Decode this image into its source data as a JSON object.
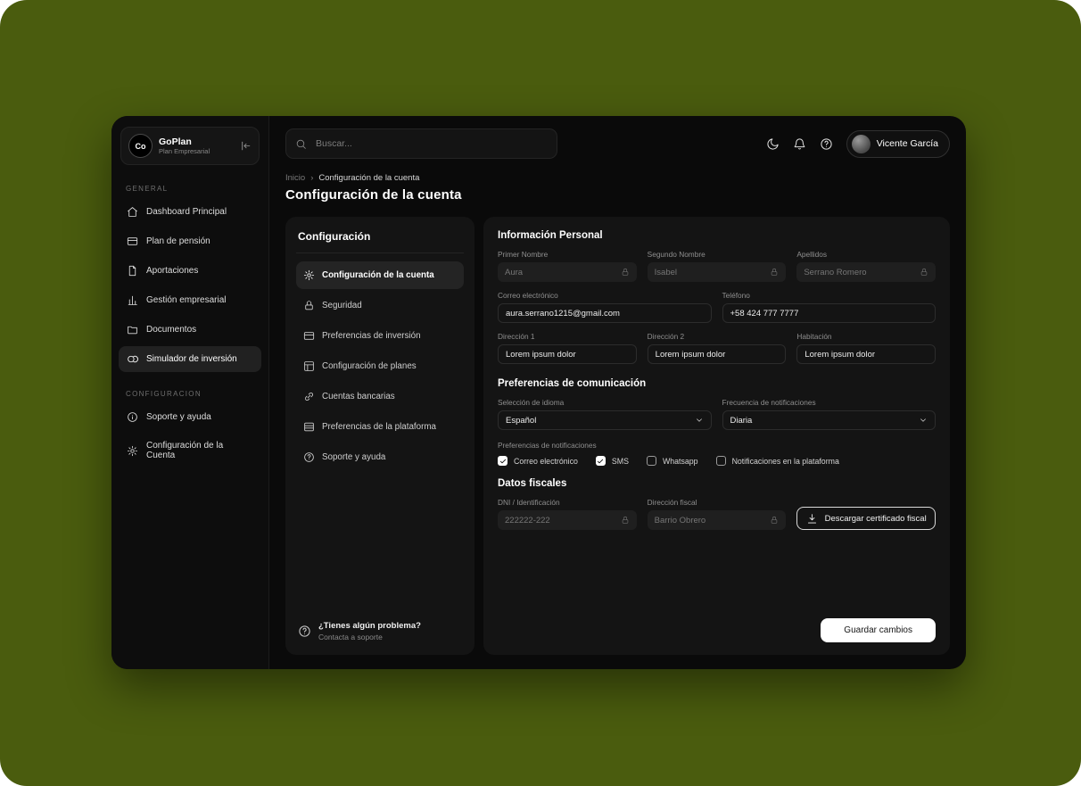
{
  "theme": {
    "background_green": "#4a5c0e",
    "window_bg": "#0a0a0a",
    "panel_bg": "#141414",
    "accent_white": "#ffffff",
    "locked_field_bg": "#1f1f1f"
  },
  "sidebar": {
    "logo": {
      "monogram": "Co",
      "name": "GoPlan",
      "subtitle": "Plan Empresarial"
    },
    "sections": [
      {
        "label": "GENERAL",
        "items": [
          {
            "icon": "home-icon",
            "label": "Dashboard Principal"
          },
          {
            "icon": "credit-card-icon",
            "label": "Plan de pensión"
          },
          {
            "icon": "file-icon",
            "label": "Aportaciones"
          },
          {
            "icon": "bar-chart-icon",
            "label": "Gestión empresarial"
          },
          {
            "icon": "folder-icon",
            "label": "Documentos"
          },
          {
            "icon": "coins-icon",
            "label": "Simulador de inversión",
            "active": true
          }
        ]
      },
      {
        "label": "CONFIGURACION",
        "items": [
          {
            "icon": "info-icon",
            "label": "Soporte y ayuda"
          },
          {
            "icon": "gear-icon",
            "label": "Configuración de la Cuenta"
          }
        ]
      }
    ]
  },
  "topbar": {
    "search_placeholder": "Buscar...",
    "user_name": "Vicente García"
  },
  "breadcrumb": {
    "home": "Inicio",
    "separator": "›",
    "current": "Configuración de la cuenta"
  },
  "page": {
    "title": "Configuración de la cuenta"
  },
  "settings_nav": {
    "title": "Configuración",
    "items": [
      {
        "label": "Configuración de la cuenta",
        "active": true
      },
      {
        "label": "Seguridad"
      },
      {
        "label": "Preferencias de inversión"
      },
      {
        "label": "Configuración de planes"
      },
      {
        "label": "Cuentas bancarias"
      },
      {
        "label": "Preferencias de la plataforma"
      },
      {
        "label": "Soporte y ayuda"
      }
    ],
    "help": {
      "title": "¿Tienes algún problema?",
      "subtitle": "Contacta a soporte"
    }
  },
  "form": {
    "personal": {
      "title": "Información Personal",
      "first_name": {
        "label": "Primer Nombre",
        "value": "Aura",
        "locked": true
      },
      "middle_name": {
        "label": "Segundo Nombre",
        "value": "Isabel",
        "locked": true
      },
      "last_name": {
        "label": "Apellidos",
        "value": "Serrano Romero",
        "locked": true
      },
      "email": {
        "label": "Correo electrónico",
        "value": "aura.serrano1215@gmail.com"
      },
      "phone": {
        "label": "Teléfono",
        "value": "+58 424 777 7777"
      },
      "address1": {
        "label": "Dirección 1",
        "value": "Lorem ipsum dolor"
      },
      "address2": {
        "label": "Dirección 2",
        "value": "Lorem ipsum dolor"
      },
      "room": {
        "label": "Habitación",
        "value": "Lorem ipsum dolor"
      }
    },
    "communication": {
      "title": "Preferencias de comunicación",
      "language": {
        "label": "Selección de idioma",
        "value": "Español"
      },
      "frequency": {
        "label": "Frecuencia de notificaciones",
        "value": "Diaria"
      },
      "notif_label": "Preferencias de notificaciones",
      "checkboxes": [
        {
          "label": "Correo electrónico",
          "checked": true
        },
        {
          "label": "SMS",
          "checked": true
        },
        {
          "label": "Whatsapp",
          "checked": false
        },
        {
          "label": "Notificaciones en la plataforma",
          "checked": false
        }
      ]
    },
    "fiscal": {
      "title": "Datos fiscales",
      "dni": {
        "label": "DNI / Identificación",
        "value": "222222-222",
        "locked": true
      },
      "address": {
        "label": "Dirección fiscal",
        "value": "Barrio Obrero",
        "locked": true
      },
      "download_label": "Descargar certificado fiscal"
    },
    "save_label": "Guardar cambios"
  }
}
